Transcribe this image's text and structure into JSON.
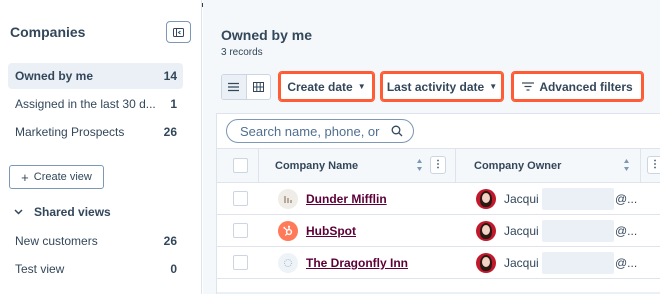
{
  "sidebar": {
    "title": "Companies",
    "views": [
      {
        "label": "Owned by me",
        "count": "14"
      },
      {
        "label": "Assigned in the last 30 d...",
        "count": "1"
      },
      {
        "label": "Marketing Prospects",
        "count": "26"
      }
    ],
    "create_view_label": "Create view",
    "shared_views_label": "Shared views",
    "shared_views": [
      {
        "label": "New customers",
        "count": "26"
      },
      {
        "label": "Test view",
        "count": "0"
      }
    ]
  },
  "main": {
    "title": "Owned by me",
    "record_count": "3 records",
    "filters": {
      "create_date": "Create date",
      "last_activity_date": "Last activity date",
      "advanced_filters": "Advanced filters"
    },
    "search": {
      "placeholder": "Search name, phone, or"
    },
    "columns": {
      "company_name": "Company Name",
      "company_owner": "Company Owner"
    },
    "rows": [
      {
        "company": "Dunder Mifflin",
        "logo_icon": "building-icon",
        "owner": "Jacqui",
        "owner_email_suffix": "@..."
      },
      {
        "company": "HubSpot",
        "logo_icon": "hubspot-sprocket-icon",
        "owner": "Jacqui",
        "owner_email_suffix": "@..."
      },
      {
        "company": "The Dragonfly Inn",
        "logo_icon": "dragonfly-logo-icon",
        "owner": "Jacqui",
        "owner_email_suffix": "@..."
      }
    ]
  },
  "colors": {
    "highlight_border": "#ff5c35",
    "link": "#5c0037",
    "text": "#33475b",
    "hubspot_orange": "#ff7a59"
  }
}
